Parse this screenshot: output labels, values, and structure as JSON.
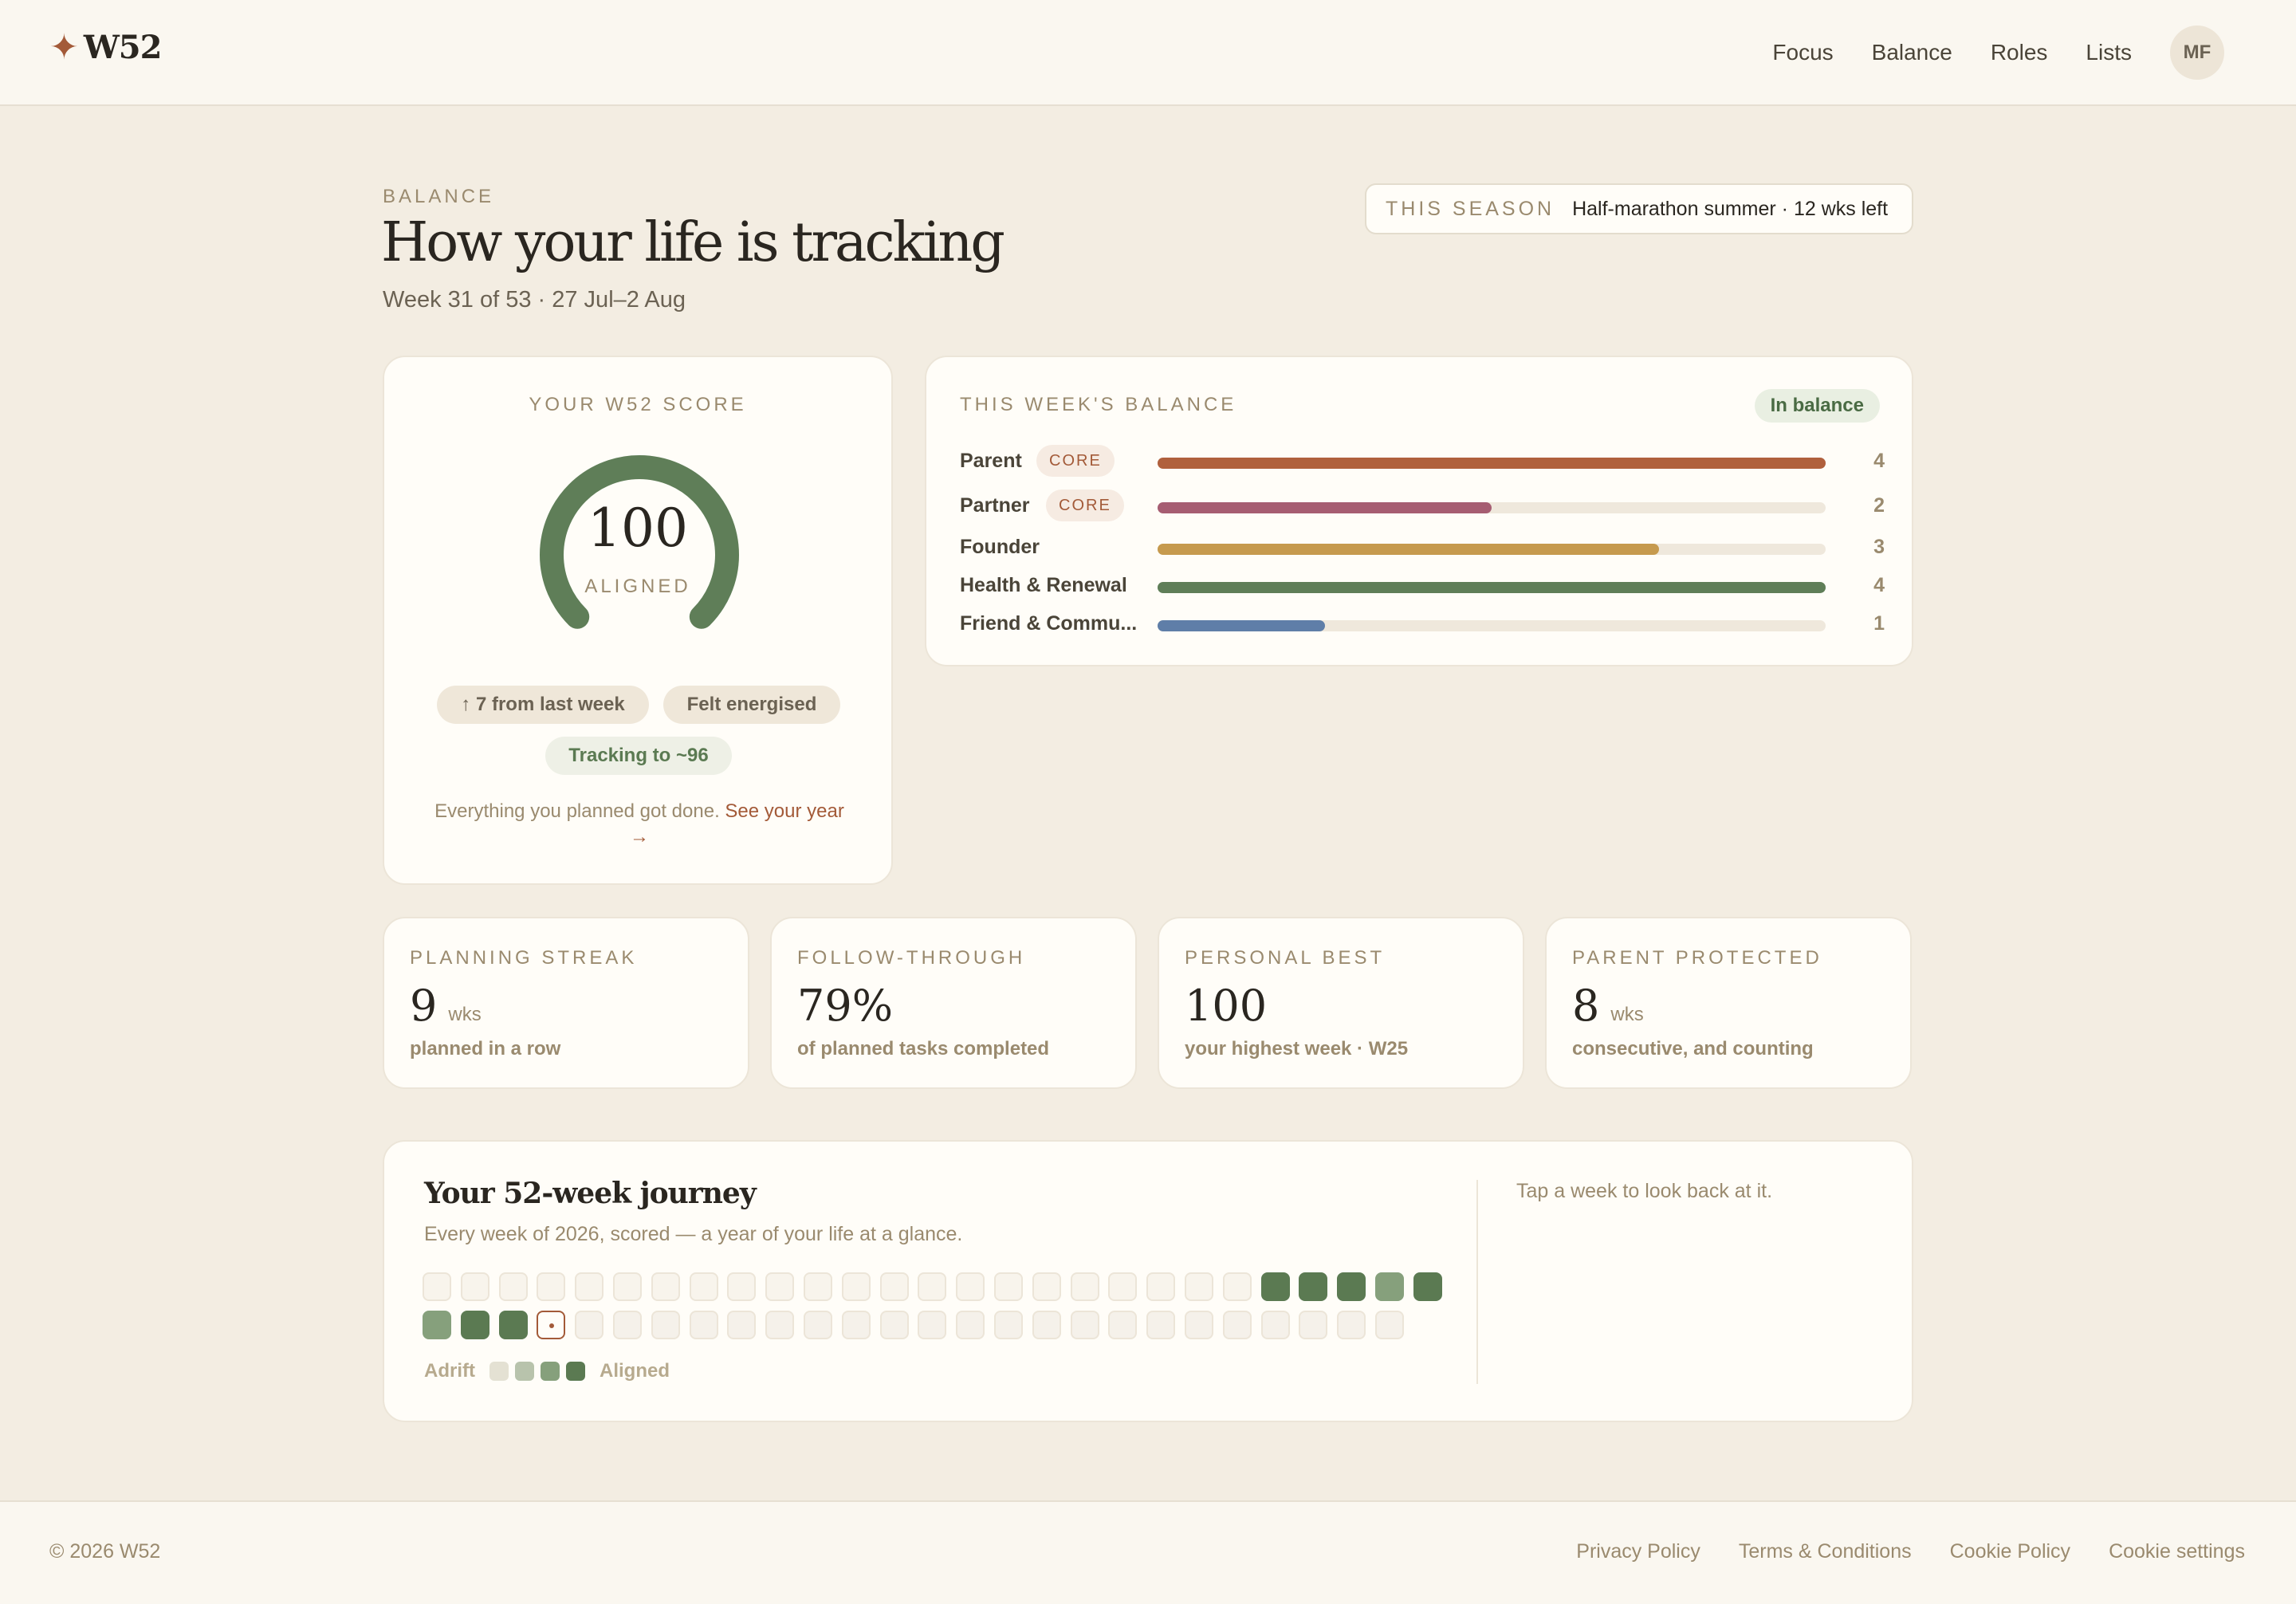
{
  "header": {
    "brand": "W52",
    "nav": [
      "Focus",
      "Balance",
      "Roles",
      "Lists"
    ],
    "avatar_initials": "MF"
  },
  "page": {
    "eyebrow": "BALANCE",
    "title": "How your life is tracking",
    "subtitle": "Week 31 of 53 · 27 Jul–2 Aug",
    "season_label": "THIS SEASON",
    "season_value": "Half-marathon summer · 12 wks left"
  },
  "score": {
    "eyebrow": "YOUR W52 SCORE",
    "value": "100",
    "label": "ALIGNED",
    "gauge_fraction": 1.0,
    "pills": [
      "↑ 7 from last week",
      "Felt energised",
      "Tracking to ~96"
    ],
    "note": "Everything you planned got done.",
    "link": "See your year",
    "link_arrow": "→"
  },
  "balance": {
    "eyebrow": "THIS WEEK'S BALANCE",
    "status": "In balance",
    "core_label": "CORE",
    "max": 4,
    "roles": [
      {
        "name": "Parent",
        "core": true,
        "value": "4",
        "fraction": 1.0,
        "color": "#b0603d"
      },
      {
        "name": "Partner",
        "core": true,
        "value": "2",
        "fraction": 0.5,
        "color": "#a65d72"
      },
      {
        "name": "Founder",
        "core": false,
        "value": "3",
        "fraction": 0.75,
        "color": "#c69a4e"
      },
      {
        "name": "Health & Renewal",
        "core": false,
        "value": "4",
        "fraction": 1.0,
        "color": "#5f7e58"
      },
      {
        "name": "Friend & Commu...",
        "core": false,
        "value": "1",
        "fraction": 0.25,
        "color": "#5f7ea8"
      }
    ]
  },
  "stats": [
    {
      "eyebrow": "PLANNING STREAK",
      "value": "9",
      "unit": "wks",
      "caption": "planned in a row"
    },
    {
      "eyebrow": "FOLLOW-THROUGH",
      "value": "79%",
      "unit": "",
      "caption": "of planned tasks completed"
    },
    {
      "eyebrow": "PERSONAL BEST",
      "value": "100",
      "unit": "",
      "caption": "your highest week · W25"
    },
    {
      "eyebrow": "PARENT PROTECTED",
      "value": "8",
      "unit": "wks",
      "caption": "consecutive, and counting"
    }
  ],
  "journey": {
    "title": "Your 52-week journey",
    "subtitle": "Every week of 2026, scored — a year of your life at a glance.",
    "hint": "Tap a week to look back at it.",
    "legend_low": "Adrift",
    "legend_high": "Aligned",
    "legend_colors": [
      "#e4e1d3",
      "#b8c3ac",
      "#86a07c",
      "#5b7a52"
    ],
    "current_week": 31,
    "week_levels": [
      0,
      0,
      0,
      0,
      0,
      0,
      0,
      0,
      0,
      0,
      0,
      0,
      0,
      0,
      0,
      0,
      0,
      0,
      0,
      0,
      0,
      0,
      4,
      4,
      4,
      3,
      4,
      3,
      4,
      4,
      0,
      0,
      0,
      0,
      0,
      0,
      0,
      0,
      0,
      0,
      0,
      0,
      0,
      0,
      0,
      0,
      0,
      0,
      0,
      0,
      0,
      0,
      0
    ],
    "week_past_colors": [
      "#f8f4ec",
      "#e4e1d3",
      "#b8c3ac",
      "#86a07c",
      "#5b7a52"
    ]
  },
  "footer": {
    "copyright": "© 2026 W52",
    "links": [
      "Privacy Policy",
      "Terms & Conditions",
      "Cookie Policy",
      "Cookie settings"
    ]
  }
}
